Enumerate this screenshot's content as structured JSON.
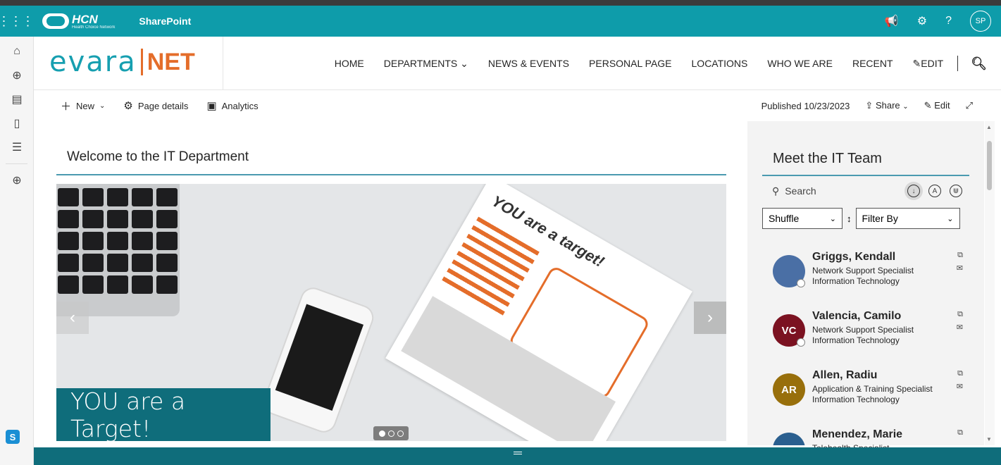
{
  "suite": {
    "org": "HCN",
    "org_tag": "Health Choice Network",
    "app": "SharePoint",
    "user_initials": "SP"
  },
  "brand": {
    "left": "evara",
    "right": "NET"
  },
  "nav": [
    "HOME",
    "DEPARTMENTS",
    "NEWS & EVENTS",
    "PERSONAL PAGE",
    "LOCATIONS",
    "WHO WE ARE",
    "RECENT",
    "EDIT"
  ],
  "commands": {
    "new": "New",
    "page_details": "Page details",
    "analytics": "Analytics",
    "published": "Published 10/23/2023",
    "share": "Share",
    "edit": "Edit"
  },
  "main": {
    "title": "Welcome to the IT Department",
    "caption": "YOU are a Target!",
    "poster_title": "YOU are a target!"
  },
  "team": {
    "title": "Meet the IT Team",
    "search_placeholder": "Search",
    "sort": "Shuffle",
    "filter": "Filter By",
    "people": [
      {
        "name": "Griggs, Kendall",
        "title": "Network Support Specialist",
        "dept": "Information Technology",
        "initials": "",
        "color": "#4a6fa5"
      },
      {
        "name": "Valencia, Camilo",
        "title": "Network Support Specialist",
        "dept": "Information Technology",
        "initials": "VC",
        "color": "#7b1221"
      },
      {
        "name": "Allen, Radiu",
        "title": "Application & Training Specialist",
        "dept": "Information Technology",
        "initials": "AR",
        "color": "#986f0b"
      },
      {
        "name": "Menendez, Marie",
        "title": "Telehealth Specialist",
        "dept": "",
        "initials": "",
        "color": "#2a5f8f"
      }
    ]
  }
}
